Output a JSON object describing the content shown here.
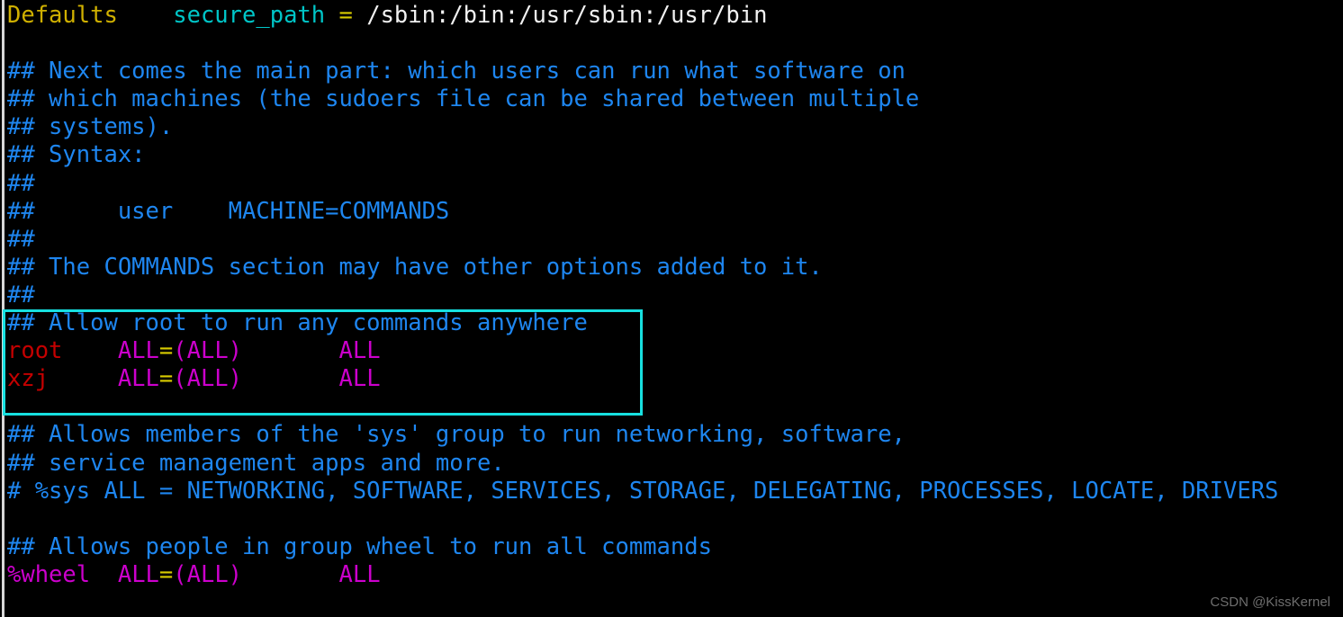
{
  "window": {
    "title": "sudoers",
    "background_color": "#000000",
    "foreground_color": "#1e86f0",
    "highlight_color": "#17e0e0"
  },
  "watermark": {
    "text": "CSDN @KissKernel"
  },
  "lines": [
    {
      "id": 1,
      "segments": [
        {
          "text": "Defaults",
          "class": "c-keyword"
        },
        {
          "text": "    ",
          "class": "c-plain"
        },
        {
          "text": "secure_path",
          "class": "c-param"
        },
        {
          "text": " ",
          "class": "c-plain"
        },
        {
          "text": "=",
          "class": "c-eq"
        },
        {
          "text": " ",
          "class": "c-plain"
        },
        {
          "text": "/sbin:/bin:/usr/sbin:/usr/bin",
          "class": "c-path"
        }
      ]
    },
    {
      "id": 2,
      "segments": []
    },
    {
      "id": 3,
      "segments": [
        {
          "text": "## Next comes the main part: which users can run what software on",
          "class": "c-comment"
        }
      ]
    },
    {
      "id": 4,
      "segments": [
        {
          "text": "## which machines (the sudoers file can be shared between multiple",
          "class": "c-comment"
        }
      ]
    },
    {
      "id": 5,
      "segments": [
        {
          "text": "## systems).",
          "class": "c-comment"
        }
      ]
    },
    {
      "id": 6,
      "segments": [
        {
          "text": "## Syntax:",
          "class": "c-comment"
        }
      ]
    },
    {
      "id": 7,
      "segments": [
        {
          "text": "##",
          "class": "c-comment"
        }
      ]
    },
    {
      "id": 8,
      "segments": [
        {
          "text": "##      user    MACHINE=COMMANDS",
          "class": "c-comment"
        }
      ]
    },
    {
      "id": 9,
      "segments": [
        {
          "text": "##",
          "class": "c-comment"
        }
      ]
    },
    {
      "id": 10,
      "segments": [
        {
          "text": "## The COMMANDS section may have other options added to it.",
          "class": "c-comment"
        }
      ]
    },
    {
      "id": 11,
      "segments": [
        {
          "text": "##",
          "class": "c-comment"
        }
      ]
    },
    {
      "id": 12,
      "segments": [
        {
          "text": "## Allow root to run any commands anywhere",
          "class": "c-comment"
        }
      ]
    },
    {
      "id": 13,
      "segments": [
        {
          "text": "root",
          "class": "c-user"
        },
        {
          "text": "    ",
          "class": "c-plain"
        },
        {
          "text": "ALL",
          "class": "c-all"
        },
        {
          "text": "=",
          "class": "c-eq"
        },
        {
          "text": "(ALL)",
          "class": "c-all"
        },
        {
          "text": "       ",
          "class": "c-plain"
        },
        {
          "text": "ALL",
          "class": "c-all"
        }
      ]
    },
    {
      "id": 14,
      "segments": [
        {
          "text": "xzj",
          "class": "c-user"
        },
        {
          "text": "     ",
          "class": "c-plain"
        },
        {
          "text": "ALL",
          "class": "c-all"
        },
        {
          "text": "=",
          "class": "c-eq"
        },
        {
          "text": "(ALL)",
          "class": "c-all"
        },
        {
          "text": "       ",
          "class": "c-plain"
        },
        {
          "text": "ALL",
          "class": "c-all"
        }
      ]
    },
    {
      "id": 15,
      "segments": []
    },
    {
      "id": 16,
      "segments": [
        {
          "text": "## Allows members of the 'sys' group to run networking, software,",
          "class": "c-comment"
        }
      ]
    },
    {
      "id": 17,
      "segments": [
        {
          "text": "## service management apps and more.",
          "class": "c-comment"
        }
      ]
    },
    {
      "id": 18,
      "segments": [
        {
          "text": "# %sys ALL = NETWORKING, SOFTWARE, SERVICES, STORAGE, DELEGATING, PROCESSES, LOCATE, DRIVERS",
          "class": "c-comment"
        }
      ]
    },
    {
      "id": 19,
      "segments": []
    },
    {
      "id": 20,
      "segments": [
        {
          "text": "## Allows people in group wheel to run all commands",
          "class": "c-comment"
        }
      ]
    },
    {
      "id": 21,
      "segments": [
        {
          "text": "%wheel",
          "class": "c-group"
        },
        {
          "text": "  ",
          "class": "c-plain"
        },
        {
          "text": "ALL",
          "class": "c-all"
        },
        {
          "text": "=",
          "class": "c-eq"
        },
        {
          "text": "(ALL)",
          "class": "c-all"
        },
        {
          "text": "       ",
          "class": "c-plain"
        },
        {
          "text": "ALL",
          "class": "c-all"
        }
      ]
    }
  ]
}
